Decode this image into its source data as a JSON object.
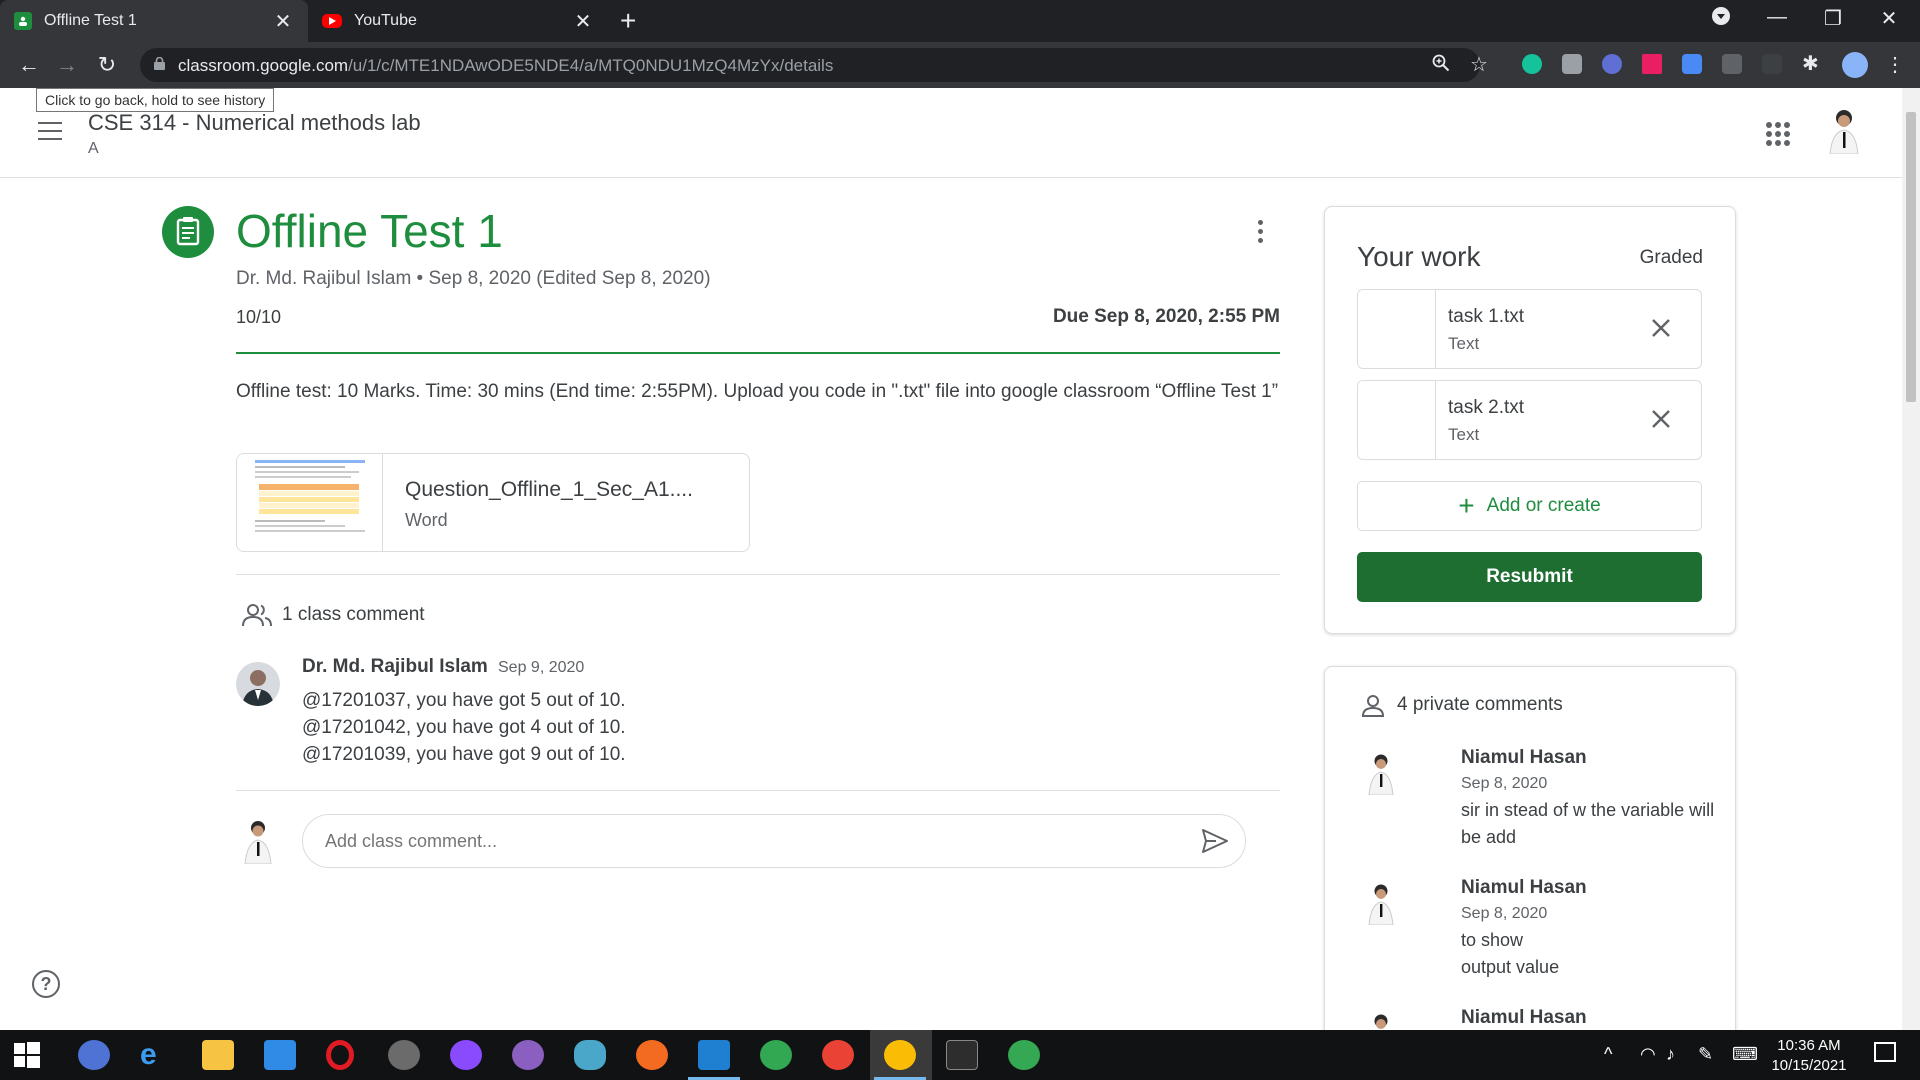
{
  "browser": {
    "tabs": [
      {
        "title": "Offline Test 1",
        "active": true
      },
      {
        "title": "YouTube",
        "active": false
      }
    ],
    "url_host": "classroom.google.com",
    "url_path": "/u/1/c/MTE1NDAwODE5NDE4/a/MTQ0NDU1MzQ4MzYx/details",
    "back_tooltip": "Click to go back, hold to see history"
  },
  "header": {
    "course_title": "CSE 314 - Numerical methods lab",
    "section": "A"
  },
  "assignment": {
    "title": "Offline Test 1",
    "meta": "Dr. Md. Rajibul Islam • Sep 8, 2020 (Edited Sep 8, 2020)",
    "points": "10/10",
    "due": "Due Sep 8, 2020, 2:55 PM",
    "description": "Offline test: 10 Marks. Time: 30 mins (End time: 2:55PM). Upload you code in \".txt\" file into google classroom “Offline Test 1”",
    "attachment": {
      "name": "Question_Offline_1_Sec_A1....",
      "type": "Word"
    }
  },
  "class_comments": {
    "count_label": "1 class comment",
    "items": [
      {
        "author": "Dr. Md. Rajibul Islam",
        "date": "Sep 9, 2020",
        "lines": [
          "@17201037, you have got 5 out of 10.",
          "@17201042, you have got 4 out of 10.",
          "@17201039, you have got 9 out of 10."
        ]
      }
    ],
    "input_placeholder": "Add class comment..."
  },
  "your_work": {
    "title": "Your work",
    "status": "Graded",
    "files": [
      {
        "name": "task 1.txt",
        "type": "Text"
      },
      {
        "name": "task 2.txt",
        "type": "Text"
      }
    ],
    "add_label": "Add or create",
    "resubmit_label": "Resubmit"
  },
  "private_comments": {
    "count_label": "4 private comments",
    "items": [
      {
        "author": "Niamul Hasan",
        "date": "Sep 8, 2020",
        "text": "sir in stead of w the variable will be add"
      },
      {
        "author": "Niamul Hasan",
        "date": "Sep 8, 2020",
        "text": "to show\n output value"
      },
      {
        "author": "Niamul Hasan",
        "date": "",
        "text": ""
      }
    ]
  },
  "taskbar": {
    "time": "10:36 AM",
    "date": "10/15/2021"
  },
  "colors": {
    "accent": "#1e8e3e",
    "resubmit": "#1e6e32",
    "chrome_dark": "#202124",
    "chrome_toolbar": "#35363a"
  }
}
